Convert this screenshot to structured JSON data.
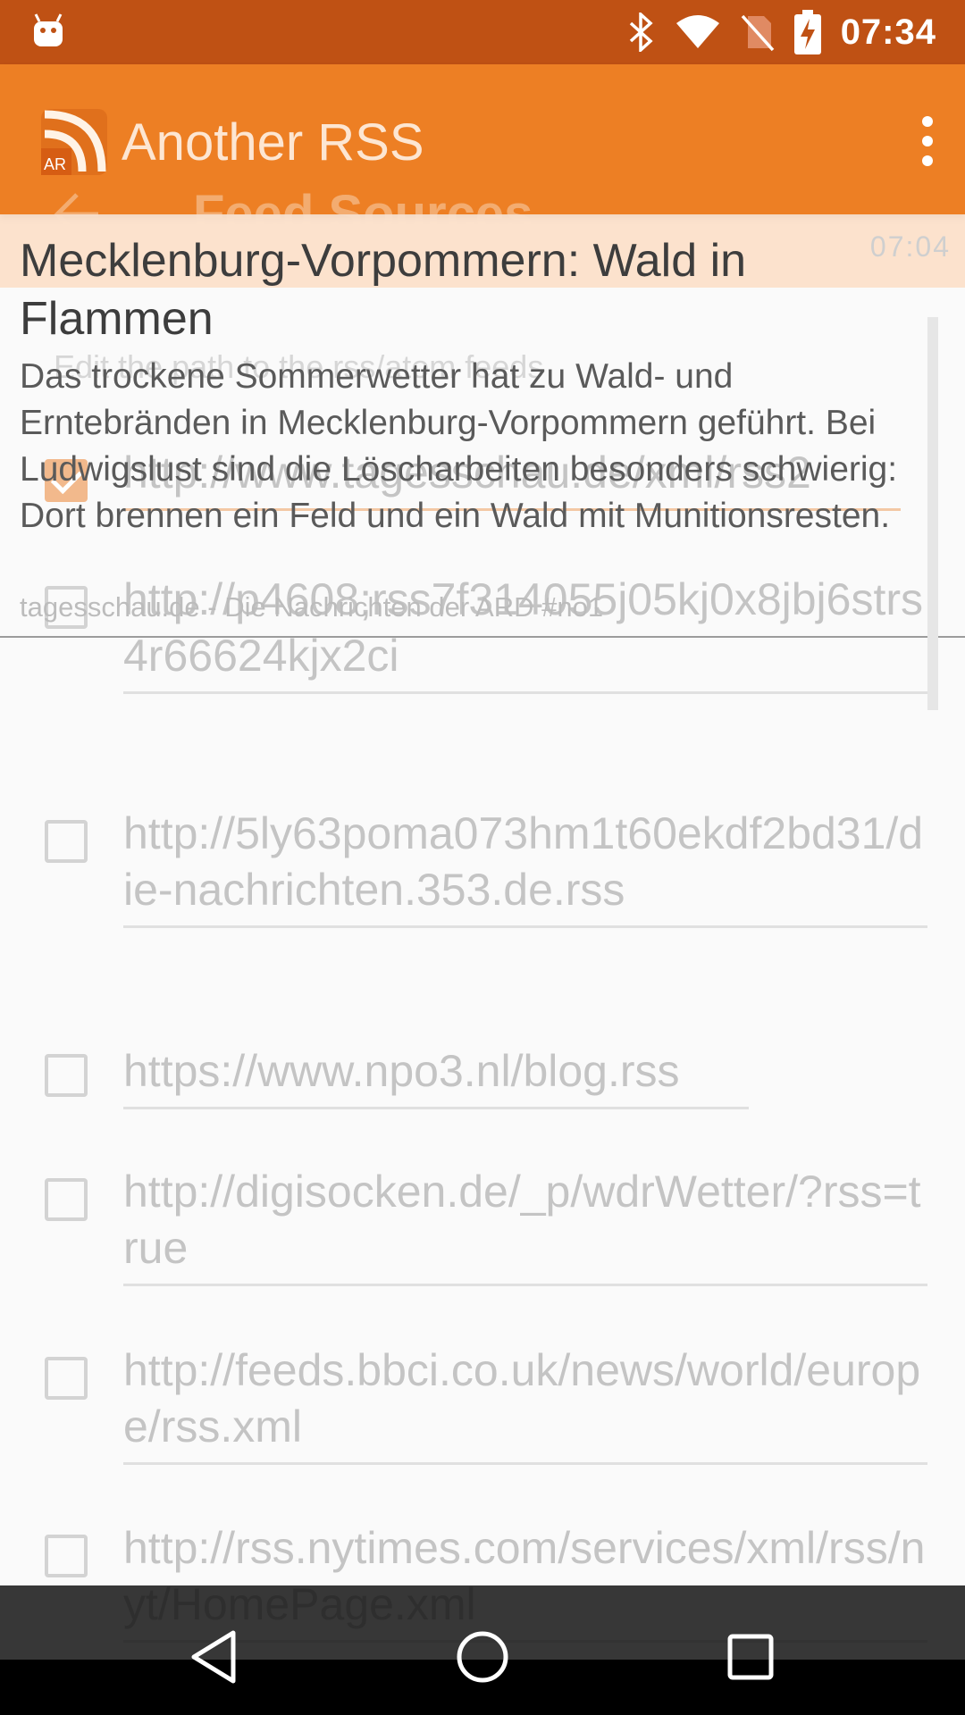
{
  "status_bar": {
    "time": "07:34",
    "icons": [
      "android-debug-icon",
      "bluetooth-icon",
      "wifi-icon",
      "no-sim-icon",
      "battery-charging-icon"
    ]
  },
  "app_bar": {
    "title": "Another RSS",
    "logo_text": "AR",
    "background_title": "Feed Sources",
    "menu_icon": "more-vert-icon"
  },
  "feed_sources": {
    "hint": "Edit the path to the rss/atom feeds",
    "items": [
      {
        "url": "http://www.tagesschau.de/xml/rss2",
        "checked": true
      },
      {
        "url": "http://p4608;rss7f314055j05kj0x8jbj6strs4r66624kjx2ci",
        "checked": false
      },
      {
        "url": "http://5ly63poma073hm1t60ekdf2bd31/die-nachrichten.353.de.rss",
        "checked": false
      },
      {
        "url": "https://www.npo3.nl/blog.rss",
        "checked": false
      },
      {
        "url": "http://digisocken.de/_p/wdrWetter/?rss=true",
        "checked": false
      },
      {
        "url": "http://feeds.bbci.co.uk/news/world/europe/rss.xml",
        "checked": false
      },
      {
        "url": "http://rss.nytimes.com/services/xml/rss/nyt/HomePage.xml",
        "checked": false
      }
    ]
  },
  "article": {
    "time": "07:04",
    "title": "Mecklenburg-Vorpommern: Wald in Flammen",
    "description": "Das trockene Sommerwetter hat zu Wald- und Erntebränden in Mecklenburg-Vorpommern geführt. Bei Ludwigslust sind die Löscharbeiten besonders schwierig: Dort brennen ein Feld und ein Wald mit Munitionsresten.",
    "source": "tagesschau.de - Die Nachrichten der ARD #no1"
  },
  "nav_bar": {
    "back": "back-triangle-icon",
    "home": "home-circle-icon",
    "recents": "recents-square-icon"
  },
  "colors": {
    "status_bar": "#bf5114",
    "app_bar": "#ed7f24",
    "article_highlight": "#fcddc4"
  }
}
